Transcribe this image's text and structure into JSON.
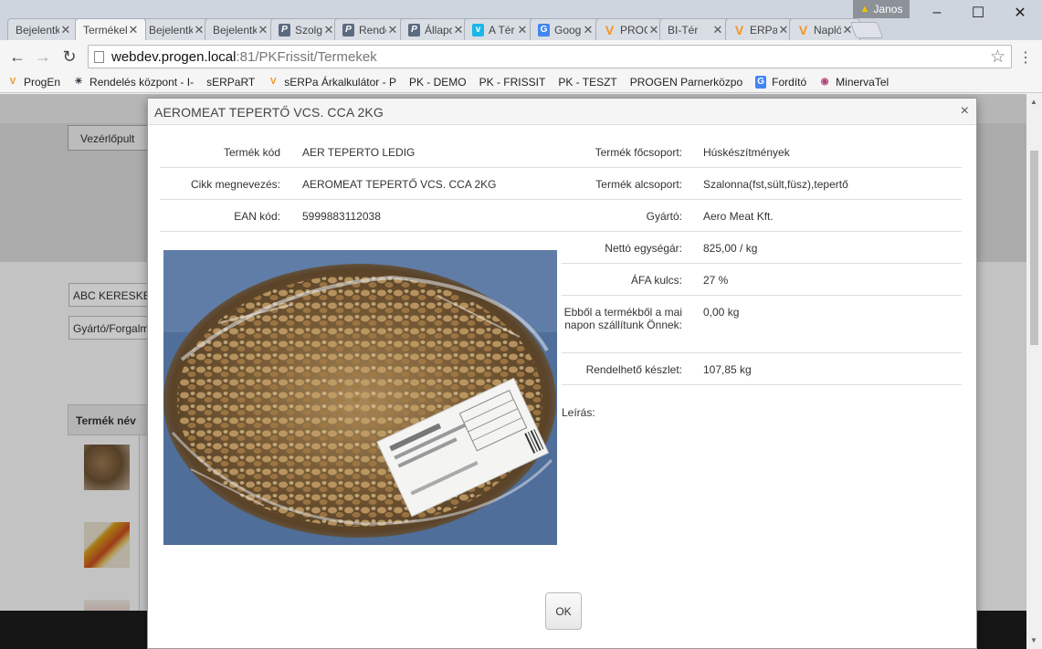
{
  "browser": {
    "tabs": [
      {
        "title": "Bejelentkezés",
        "icon": "page-icon"
      },
      {
        "title": "Termékek",
        "icon": "page-icon"
      },
      {
        "title": "Bejelentkezés",
        "icon": "page-icon"
      },
      {
        "title": "Bejelentkezés",
        "icon": "page-icon"
      },
      {
        "title": "Szolgáltatás",
        "icon": "progen-icon"
      },
      {
        "title": "Rendelés",
        "icon": "progen-icon"
      },
      {
        "title": "Állapot",
        "icon": "progen-icon"
      },
      {
        "title": "A Tér",
        "icon": "vimeo-icon"
      },
      {
        "title": "Google Fordító",
        "icon": "google-translate-icon"
      },
      {
        "title": "PROGEN",
        "icon": "serpa-icon"
      },
      {
        "title": "BI-Tér",
        "icon": "page-icon"
      },
      {
        "title": "ERPa",
        "icon": "serpa-icon"
      },
      {
        "title": "Napló",
        "icon": "serpa-icon"
      }
    ],
    "user": "Janos",
    "url_host": "webdev.progen.local",
    "url_path": ":81/PKFrissit/Termekek",
    "bookmarks": [
      {
        "label": "ProgEn",
        "icon": "serpa-icon"
      },
      {
        "label": "Rendelés központ - I-",
        "icon": "shield-icon"
      },
      {
        "label": "sERPaRT",
        "icon": "page-icon"
      },
      {
        "label": "sERPa Árkalkulátor - P",
        "icon": "serpa-icon"
      },
      {
        "label": "PK - DEMO",
        "icon": "page-icon"
      },
      {
        "label": "PK - FRISSIT",
        "icon": "page-icon"
      },
      {
        "label": "PK - TESZT",
        "icon": "page-icon"
      },
      {
        "label": "PROGEN Parnerközpo",
        "icon": "page-icon"
      },
      {
        "label": "Fordító",
        "icon": "google-translate-icon"
      },
      {
        "label": "MinervaTel",
        "icon": "minerva-icon"
      }
    ]
  },
  "background_page": {
    "dashboard_button": "Vezérlőpult",
    "search_abc": "ABC KERESKE",
    "search_manufacturer": "Gyártó/Forgalm",
    "table_header_name": "Termék név"
  },
  "modal": {
    "title": "AEROMEAT TEPERTŐ VCS. CCA 2KG",
    "left_rows": [
      {
        "label": "Termék kód",
        "value": "AER TEPERTO LEDIG"
      },
      {
        "label": "Cikk megnevezés:",
        "value": "AEROMEAT TEPERTŐ VCS. CCA 2KG"
      },
      {
        "label": "EAN kód:",
        "value": "5999883112038"
      }
    ],
    "right_rows": [
      {
        "label": "Termék főcsoport:",
        "value": "Húskészítmények"
      },
      {
        "label": "Termék alcsoport:",
        "value": "Szalonna(fst,sült,füsz),tepertő"
      },
      {
        "label": "Gyártó:",
        "value": "Aero Meat Kft."
      },
      {
        "label": "Nettó egységár:",
        "value": "825,00 / kg"
      },
      {
        "label": "ÁFA kulcs:",
        "value": "27 %"
      },
      {
        "label": "Ebből a termékből a mai napon szállítunk Önnek:",
        "value": "0,00 kg"
      },
      {
        "label": "Rendelhető készlet:",
        "value": "107,85 kg"
      }
    ],
    "description_label": "Leírás:",
    "ok_label": "OK"
  }
}
